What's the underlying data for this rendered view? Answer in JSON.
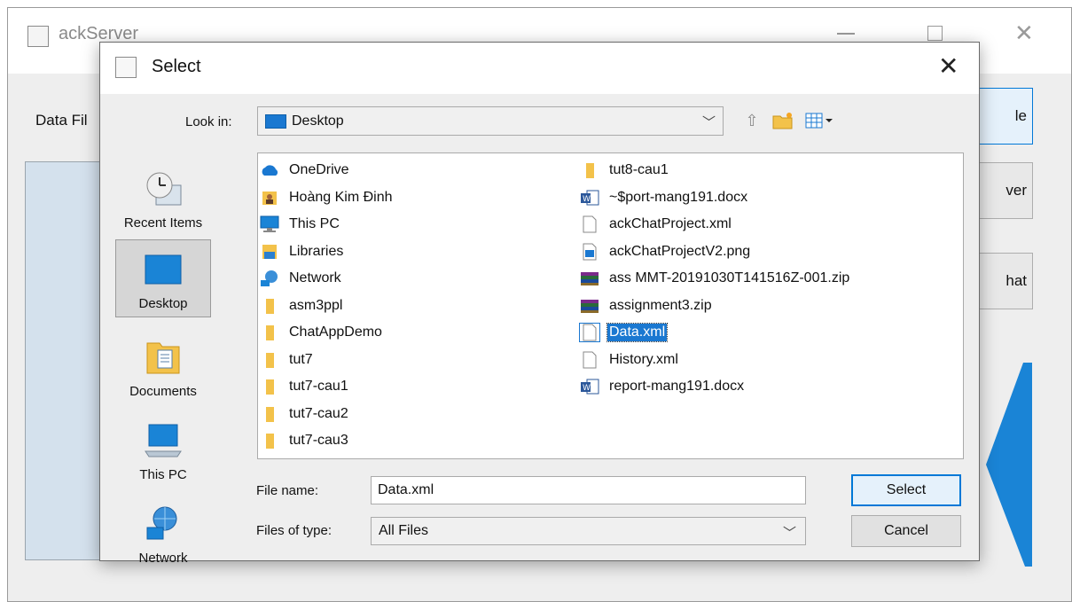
{
  "background_window": {
    "title": "ackServer",
    "data_label": "Data Fil",
    "buttons": [
      "le",
      "ver",
      "hat"
    ]
  },
  "dialog": {
    "title": "Select",
    "look_in": {
      "label": "Look in:",
      "value": "Desktop"
    },
    "places": [
      {
        "id": "recent",
        "label": "Recent Items"
      },
      {
        "id": "desktop",
        "label": "Desktop",
        "selected": true
      },
      {
        "id": "documents",
        "label": "Documents"
      },
      {
        "id": "thispc",
        "label": "This PC"
      },
      {
        "id": "network",
        "label": "Network"
      }
    ],
    "files_col1": [
      {
        "name": "OneDrive",
        "icon": "onedrive-icon"
      },
      {
        "name": "Hoàng Kim Đinh",
        "icon": "user-folder-icon"
      },
      {
        "name": "This PC",
        "icon": "computer-icon"
      },
      {
        "name": "Libraries",
        "icon": "library-icon"
      },
      {
        "name": "Network",
        "icon": "network-icon"
      },
      {
        "name": "asm3ppl",
        "icon": "folder-icon"
      },
      {
        "name": "ChatAppDemo",
        "icon": "folder-icon"
      },
      {
        "name": "tut7",
        "icon": "folder-icon"
      },
      {
        "name": "tut7-cau1",
        "icon": "folder-icon"
      },
      {
        "name": "tut7-cau2",
        "icon": "folder-icon"
      },
      {
        "name": "tut7-cau3",
        "icon": "folder-icon"
      }
    ],
    "files_col2": [
      {
        "name": "tut8-cau1",
        "icon": "folder-icon"
      },
      {
        "name": "~$port-mang191.docx",
        "icon": "word-doc-icon"
      },
      {
        "name": "ackChatProject.xml",
        "icon": "file-icon"
      },
      {
        "name": "ackChatProjectV2.png",
        "icon": "image-file-icon"
      },
      {
        "name": "ass MMT-20191030T141516Z-001.zip",
        "icon": "zip-icon"
      },
      {
        "name": "assignment3.zip",
        "icon": "zip-icon"
      },
      {
        "name": "Data.xml",
        "icon": "file-icon",
        "selected": true
      },
      {
        "name": "History.xml",
        "icon": "file-icon"
      },
      {
        "name": "report-mang191.docx",
        "icon": "word-doc-icon"
      }
    ],
    "file_name": {
      "label": "File name:",
      "value": "Data.xml"
    },
    "file_type": {
      "label": "Files of type:",
      "value": "All Files"
    },
    "select_button": "Select",
    "cancel_button": "Cancel"
  },
  "colors": {
    "accent": "#0078d7",
    "selection": "#1a78d1",
    "folder": "#e6b22e"
  }
}
